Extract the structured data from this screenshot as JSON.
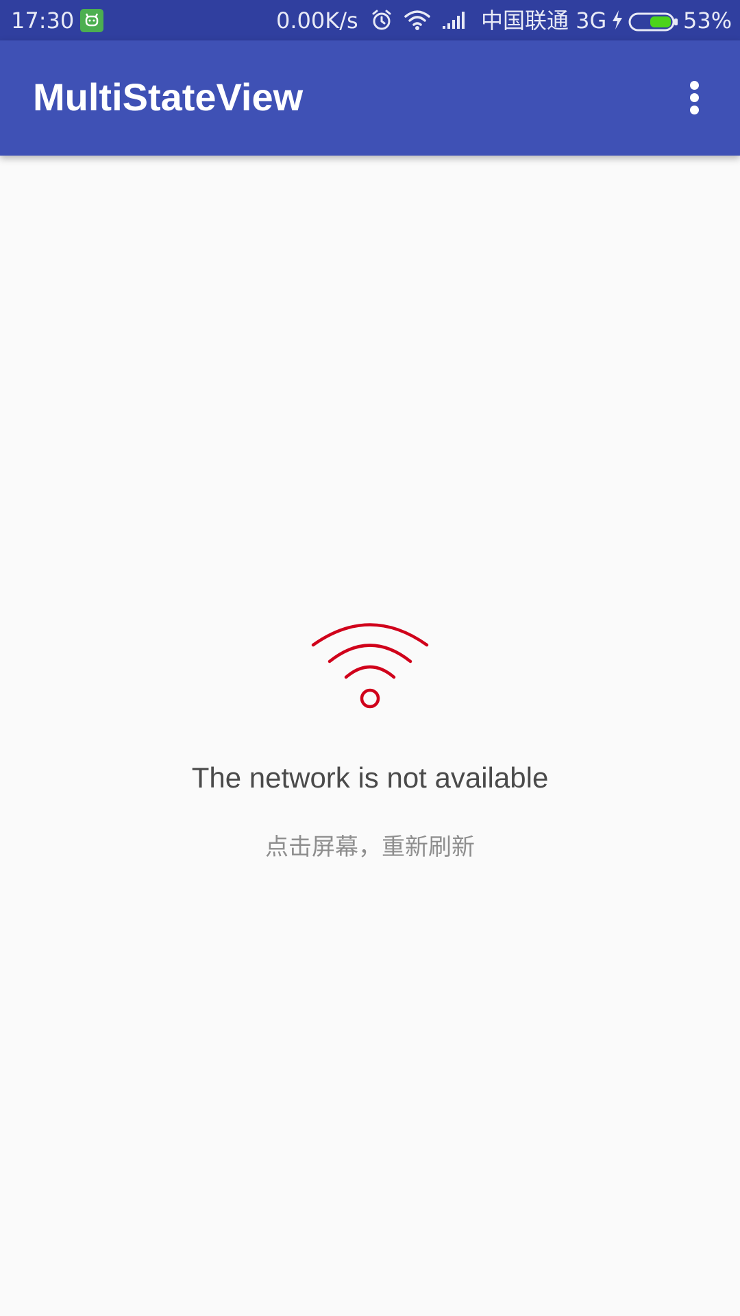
{
  "status_bar": {
    "time": "17:30",
    "net_speed": "0.00K/s",
    "carrier": "中国联通 3G",
    "battery_percent": "53%",
    "battery_level": 0.53,
    "icons": [
      "app-notification-icon",
      "alarm-icon",
      "wifi-icon",
      "signal-icon",
      "charging-icon",
      "battery-icon"
    ]
  },
  "app_bar": {
    "title": "MultiStateView",
    "overflow_icon": "more-vert-icon"
  },
  "error_state": {
    "icon": "wifi-icon",
    "icon_color": "#d0021b",
    "title": "The network is not available",
    "hint": "点击屏幕，重新刷新"
  },
  "colors": {
    "status_bar": "#303f9f",
    "app_bar": "#3f51b5",
    "background": "#fafafa"
  }
}
